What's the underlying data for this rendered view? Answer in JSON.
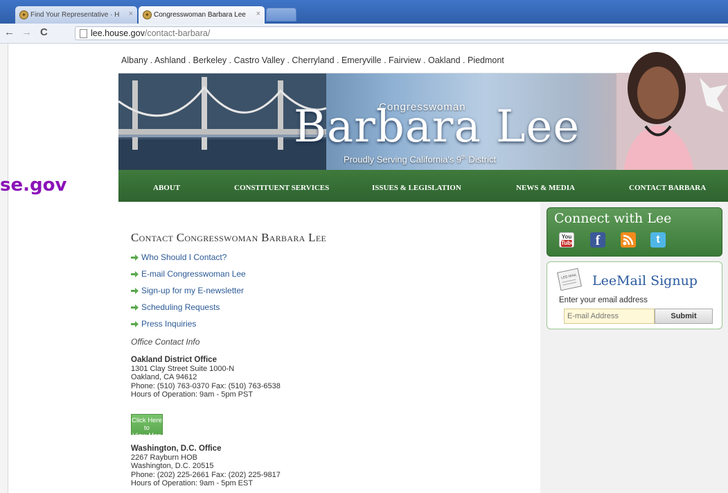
{
  "slide_text": "se.gov",
  "browser": {
    "tabs": [
      {
        "label": "Find Your Representative · H"
      },
      {
        "label": "Congresswoman Barbara Lee"
      }
    ],
    "url_host": "lee.house.gov",
    "url_path": "/contact-barbara/"
  },
  "site": {
    "cities": "Albany . Ashland . Berkeley . Castro Valley . Cherryland . Emeryville . Fairview . Oakland . Piedmont",
    "header_small": "Congresswoman",
    "header_name": "Barbara Lee",
    "header_tagline": "Proudly Serving California's 9",
    "header_tagline_sup": "th",
    "header_tagline_end": " District",
    "nav": [
      "ABOUT",
      "CONSTITUENT SERVICES",
      "ISSUES & LEGISLATION",
      "NEWS & MEDIA",
      "CONTACT BARBARA"
    ]
  },
  "contact": {
    "title": "Contact Congresswoman Barbara Lee",
    "links": [
      "Who Should I Contact?",
      "E-mail Congresswoman Lee",
      "Sign-up for my E-newsletter",
      "Scheduling Requests",
      "Press Inquiries"
    ],
    "office_info_label": "Office Contact Info",
    "offices": [
      {
        "name": "Oakland District Office",
        "line1": "1301 Clay Street Suite 1000-N",
        "line2": "Oakland, CA 94612",
        "phone": "Phone: (510) 763-0370 Fax: (510) 763-6538",
        "hours": "Hours of Operation: 9am - 5pm PST"
      },
      {
        "name": "Washington, D.C. Office",
        "line1": "2267 Rayburn HOB",
        "line2": "Washington, D.C. 20515",
        "phone": "Phone: (202) 225-2661 Fax: (202) 225-9817",
        "hours": "Hours of Operation: 9am - 5pm EST"
      }
    ],
    "map_button_line1": "Click Here to",
    "map_button_line2": "View Map"
  },
  "sidebar": {
    "connect_title": "Connect with Lee",
    "social_icons": [
      "youtube-icon",
      "facebook-icon",
      "rss-icon",
      "twitter-icon"
    ],
    "youtube_you": "You",
    "youtube_tube": "Tube",
    "facebook_glyph": "f",
    "twitter_glyph": "t",
    "leemail_icon_text": "LEE-MAIL",
    "leemail_title": "LeeMail Signup",
    "email_label": "Enter your email address",
    "email_placeholder": "E-mail Address",
    "submit_label": "Submit"
  },
  "colors": {
    "nav_green": "#2e6330",
    "link_blue": "#2c5a96",
    "slide_purple": "#8a12b8",
    "map_button_green": "#5aa84d"
  }
}
